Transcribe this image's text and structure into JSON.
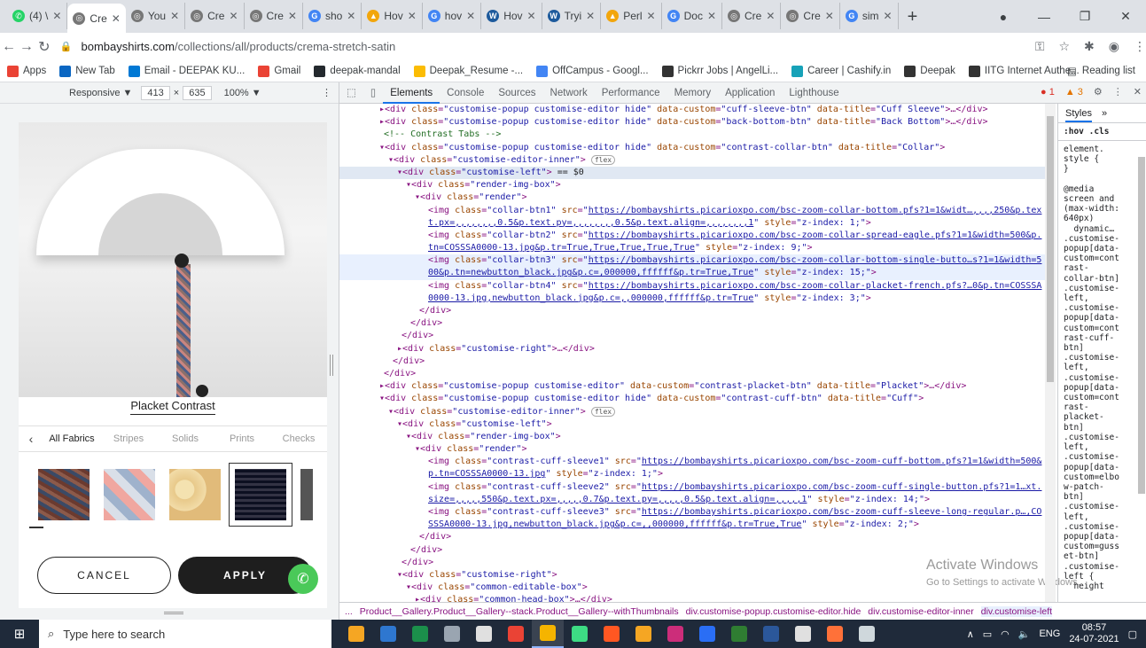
{
  "browser": {
    "tabs": [
      {
        "label": "(4) \\",
        "color": "#25d366",
        "glyph": "✆"
      },
      {
        "label": "Cre",
        "color": "#777777",
        "glyph": "◎",
        "active": true
      },
      {
        "label": "You",
        "color": "#777777",
        "glyph": "◎"
      },
      {
        "label": "Cre",
        "color": "#777777",
        "glyph": "◎"
      },
      {
        "label": "Cre",
        "color": "#777777",
        "glyph": "◎"
      },
      {
        "label": "sho",
        "color": "#4285f4",
        "glyph": "G"
      },
      {
        "label": "Hov",
        "color": "#f2a60c",
        "glyph": "▲"
      },
      {
        "label": "hov",
        "color": "#4285f4",
        "glyph": "G"
      },
      {
        "label": "Hov",
        "color": "#1d5a9c",
        "glyph": "W"
      },
      {
        "label": "Tryi",
        "color": "#1d5a9c",
        "glyph": "W"
      },
      {
        "label": "Perl",
        "color": "#f2a60c",
        "glyph": "▲"
      },
      {
        "label": "Doc",
        "color": "#4285f4",
        "glyph": "G"
      },
      {
        "label": "Cre",
        "color": "#777777",
        "glyph": "◎"
      },
      {
        "label": "Cre",
        "color": "#777777",
        "glyph": "◎"
      },
      {
        "label": "sim",
        "color": "#4285f4",
        "glyph": "G"
      }
    ],
    "url_host": "bombayshirts.com",
    "url_path": "/collections/all/products/crema-stretch-satin",
    "bookmarks": [
      {
        "label": "Apps",
        "color": "#ea4335"
      },
      {
        "label": "New Tab",
        "color": "#0a66c2"
      },
      {
        "label": "Email - DEEPAK KU...",
        "color": "#0078d4"
      },
      {
        "label": "Gmail",
        "color": "#ea4335"
      },
      {
        "label": "deepak-mandal",
        "color": "#24292e"
      },
      {
        "label": "Deepak_Resume -...",
        "color": "#fbbc04"
      },
      {
        "label": "OffCampus - Googl...",
        "color": "#4285f4"
      },
      {
        "label": "Pickrr Jobs | AngelLi...",
        "color": "#333333"
      },
      {
        "label": "Career | Cashify.in",
        "color": "#17a2b8"
      },
      {
        "label": "Deepak",
        "color": "#333333"
      },
      {
        "label": "IITG Internet Authe...",
        "color": "#333333"
      }
    ],
    "reading_list": "Reading list"
  },
  "device_toolbar": {
    "mode": "Responsive ▼",
    "width": "413",
    "times": "×",
    "height": "635",
    "zoom": "100% ▼"
  },
  "mobile": {
    "placket_title": "Placket Contrast",
    "filters": [
      "All Fabrics",
      "Stripes",
      "Solids",
      "Prints",
      "Checks"
    ],
    "cancel": "CANCEL",
    "apply": "APPLY"
  },
  "devtools": {
    "tabs": [
      "Elements",
      "Console",
      "Sources",
      "Network",
      "Performance",
      "Memory",
      "Application",
      "Lighthouse"
    ],
    "errors": "1",
    "warnings": "3",
    "styles_tab": "Styles",
    "styles_more": "»",
    "styles_filter": ":hov .cls",
    "styles_text": "element.\nstyle {\n}\n\n@media\nscreen and\n(max-width:\n640px)\n  dynamic…\n.customise-\npopup[data-\ncustom=cont\nrast-\ncollar-btn]\n.customise-\nleft,\n.customise-\npopup[data-\ncustom=cont\nrast-cuff-\nbtn]\n.customise-\nleft,\n.customise-\npopup[data-\ncustom=cont\nrast-\nplacket-\nbtn]\n.customise-\nleft,\n.customise-\npopup[data-\ncustom=elbo\nw-patch-\nbtn]\n.customise-\nleft,\n.customise-\npopup[data-\ncustom=guss\net-btn]\n.customise-\nleft {\n  height",
    "activate_title": "Activate Windows",
    "activate_sub": "Go to Settings to activate Windows.",
    "breadcrumbs": [
      "...",
      "Product__Gallery.Product__Gallery--stack.Product__Gallery--withThumbnails",
      "div.customise-popup.customise-editor.hide",
      "div.customise-editor-inner",
      "div.customise-left"
    ],
    "code_lines": [
      {
        "indent": 9,
        "html": "▸<span class='tag'>&lt;div</span> <span class='attr'>class</span>=<span class='val'>\"customise-popup customise-editor hide\"</span> <span class='attr'>data-custom</span>=<span class='val'>\"cuff-sleeve-btn\"</span> <span class='attr'>data-title</span>=<span class='val'>\"Cuff Sleeve\"</span><span class='tag'>&gt;</span>…<span class='tag'>&lt;/div&gt;</span>"
      },
      {
        "indent": 9,
        "html": "▸<span class='tag'>&lt;div</span> <span class='attr'>class</span>=<span class='val'>\"customise-popup customise-editor hide\"</span> <span class='attr'>data-custom</span>=<span class='val'>\"back-bottom-btn\"</span> <span class='attr'>data-title</span>=<span class='val'>\"Back Bottom\"</span><span class='tag'>&gt;</span>…<span class='tag'>&lt;/div&gt;</span>"
      },
      {
        "indent": 10,
        "html": "<span class='cmt'>&lt;!-- Contrast Tabs --&gt;</span>"
      },
      {
        "indent": 9,
        "html": "▾<span class='tag'>&lt;div</span> <span class='attr'>class</span>=<span class='val'>\"customise-popup customise-editor hide\"</span> <span class='attr'>data-custom</span>=<span class='val'>\"contrast-collar-btn\"</span> <span class='attr'>data-title</span>=<span class='val'>\"Collar\"</span><span class='tag'>&gt;</span>"
      },
      {
        "indent": 11,
        "html": "▾<span class='tag'>&lt;div</span> <span class='attr'>class</span>=<span class='val'>\"customise-editor-inner\"</span><span class='tag'>&gt;</span> <span class='badge'>flex</span>"
      },
      {
        "indent": 13,
        "hl": true,
        "html": "▾<span class='tag'>&lt;div</span> <span class='attr'>class</span>=<span class='val'>\"customise-left\"</span><span class='tag'>&gt;</span> <span class='txt'>== $0</span>"
      },
      {
        "indent": 15,
        "html": "▾<span class='tag'>&lt;div</span> <span class='attr'>class</span>=<span class='val'>\"render-img-box\"</span><span class='tag'>&gt;</span>"
      },
      {
        "indent": 17,
        "html": "▾<span class='tag'>&lt;div</span> <span class='attr'>class</span>=<span class='val'>\"render\"</span><span class='tag'>&gt;</span>"
      },
      {
        "indent": 20,
        "html": "<span class='tag'>&lt;img</span> <span class='attr'>class</span>=<span class='val'>\"collar-btn1\"</span> <span class='attr'>src</span>=<span class='val'>\"</span><span class='link'>https://bombayshirts.picarioxpo.com/bsc-zoom-collar-bottom.pfs?1=1&amp;widt…,,,,250&amp;p.tex</span>"
      },
      {
        "indent": 20,
        "html": "<span class='link'>t.px=,,,,,,,,0.5&amp;p.text.py=,,,,,,,,0.5&amp;p.text.align=,,,,,,,,1</span><span class='val'>\"</span> <span class='attr'>style</span>=<span class='val'>\"z-index: 1;\"</span><span class='tag'>&gt;</span>"
      },
      {
        "indent": 20,
        "html": "<span class='tag'>&lt;img</span> <span class='attr'>class</span>=<span class='val'>\"collar-btn2\"</span> <span class='attr'>src</span>=<span class='val'>\"</span><span class='link'>https://bombayshirts.picarioxpo.com/bsc-zoom-collar-spread-eagle.pfs?1=1&amp;width=500&amp;p.</span>"
      },
      {
        "indent": 20,
        "html": "<span class='link'>tn=COSSSA0000-13.jpg&amp;p.tr=True,True,True,True,True</span><span class='val'>\"</span> <span class='attr'>style</span>=<span class='val'>\"z-index: 9;\"</span><span class='tag'>&gt;</span>"
      },
      {
        "indent": 20,
        "hl2": true,
        "html": "<span class='tag'>&lt;img</span> <span class='attr'>class</span>=<span class='val'>\"collar-btn3\"</span> <span class='attr'>src</span>=<span class='val'>\"</span><span class='link'>https://bombayshirts.picarioxpo.com/bsc-zoom-collar-bottom-single-butto…s?1=1&amp;width=5</span>"
      },
      {
        "indent": 20,
        "hl2": true,
        "html": "<span class='link'>00&amp;p.tn=newbutton_black.jpg&amp;p.c=,000000,ffffff&amp;p.tr=True,True</span><span class='val'>\"</span> <span class='attr'>style</span>=<span class='val'>\"z-index: 15;\"</span><span class='tag'>&gt;</span>"
      },
      {
        "indent": 20,
        "html": "<span class='tag'>&lt;img</span> <span class='attr'>class</span>=<span class='val'>\"collar-btn4\"</span> <span class='attr'>src</span>=<span class='val'>\"</span><span class='link'>https://bombayshirts.picarioxpo.com/bsc-zoom-collar-placket-french.pfs?…0&amp;p.tn=COSSSA</span>"
      },
      {
        "indent": 20,
        "html": "<span class='link'>0000-13.jpg,newbutton_black.jpg&amp;p.c=,,000000,ffffff&amp;p.tr=True</span><span class='val'>\"</span> <span class='attr'>style</span>=<span class='val'>\"z-index: 3;\"</span><span class='tag'>&gt;</span>"
      },
      {
        "indent": 18,
        "html": "<span class='tag'>&lt;/div&gt;</span>"
      },
      {
        "indent": 16,
        "html": "<span class='tag'>&lt;/div&gt;</span>"
      },
      {
        "indent": 14,
        "html": "<span class='tag'>&lt;/div&gt;</span>"
      },
      {
        "indent": 13,
        "html": "▸<span class='tag'>&lt;div</span> <span class='attr'>class</span>=<span class='val'>\"customise-right\"</span><span class='tag'>&gt;</span>…<span class='tag'>&lt;/div&gt;</span>"
      },
      {
        "indent": 12,
        "html": "<span class='tag'>&lt;/div&gt;</span>"
      },
      {
        "indent": 10,
        "html": "<span class='tag'>&lt;/div&gt;</span>"
      },
      {
        "indent": 9,
        "html": "▸<span class='tag'>&lt;div</span> <span class='attr'>class</span>=<span class='val'>\"customise-popup customise-editor\"</span> <span class='attr'>data-custom</span>=<span class='val'>\"contrast-placket-btn\"</span> <span class='attr'>data-title</span>=<span class='val'>\"Placket\"</span><span class='tag'>&gt;</span>…<span class='tag'>&lt;/div&gt;</span>"
      },
      {
        "indent": 9,
        "html": "▾<span class='tag'>&lt;div</span> <span class='attr'>class</span>=<span class='val'>\"customise-popup customise-editor hide\"</span> <span class='attr'>data-custom</span>=<span class='val'>\"contrast-cuff-btn\"</span> <span class='attr'>data-title</span>=<span class='val'>\"Cuff\"</span><span class='tag'>&gt;</span>"
      },
      {
        "indent": 11,
        "html": "▾<span class='tag'>&lt;div</span> <span class='attr'>class</span>=<span class='val'>\"customise-editor-inner\"</span><span class='tag'>&gt;</span> <span class='badge'>flex</span>"
      },
      {
        "indent": 13,
        "html": "▾<span class='tag'>&lt;div</span> <span class='attr'>class</span>=<span class='val'>\"customise-left\"</span><span class='tag'>&gt;</span>"
      },
      {
        "indent": 15,
        "html": "▾<span class='tag'>&lt;div</span> <span class='attr'>class</span>=<span class='val'>\"render-img-box\"</span><span class='tag'>&gt;</span>"
      },
      {
        "indent": 17,
        "html": "▾<span class='tag'>&lt;div</span> <span class='attr'>class</span>=<span class='val'>\"render\"</span><span class='tag'>&gt;</span>"
      },
      {
        "indent": 20,
        "html": "<span class='tag'>&lt;img</span> <span class='attr'>class</span>=<span class='val'>\"contrast-cuff-sleeve1\"</span> <span class='attr'>src</span>=<span class='val'>\"</span><span class='link'>https://bombayshirts.picarioxpo.com/bsc-zoom-cuff-bottom.pfs?1=1&amp;width=500&amp;</span>"
      },
      {
        "indent": 20,
        "html": "<span class='link'>p.tn=COSSSA0000-13.jpg</span><span class='val'>\"</span> <span class='attr'>style</span>=<span class='val'>\"z-index: 1;\"</span><span class='tag'>&gt;</span>"
      },
      {
        "indent": 20,
        "html": "<span class='tag'>&lt;img</span> <span class='attr'>class</span>=<span class='val'>\"contrast-cuff-sleeve2\"</span> <span class='attr'>src</span>=<span class='val'>\"</span><span class='link'>https://bombayshirts.picarioxpo.com/bsc-zoom-cuff-single-button.pfs?1=1…xt.</span>"
      },
      {
        "indent": 20,
        "html": "<span class='link'>size=,,,,,550&amp;p.text.px=,,,,,0.7&amp;p.text.py=,,,,,0.5&amp;p.text.align=,,,,,1</span><span class='val'>\"</span> <span class='attr'>style</span>=<span class='val'>\"z-index: 14;\"</span><span class='tag'>&gt;</span>"
      },
      {
        "indent": 20,
        "html": "<span class='tag'>&lt;img</span> <span class='attr'>class</span>=<span class='val'>\"contrast-cuff-sleeve3\"</span> <span class='attr'>src</span>=<span class='val'>\"</span><span class='link'>https://bombayshirts.picarioxpo.com/bsc-zoom-cuff-sleeve-long-regular.p…,CO</span>"
      },
      {
        "indent": 20,
        "html": "<span class='link'>SSSA0000-13.jpg,newbutton_black.jpg&amp;p.c=,,000000,ffffff&amp;p.tr=True,True</span><span class='val'>\"</span> <span class='attr'>style</span>=<span class='val'>\"z-index: 2;\"</span><span class='tag'>&gt;</span>"
      },
      {
        "indent": 18,
        "html": "<span class='tag'>&lt;/div&gt;</span>"
      },
      {
        "indent": 16,
        "html": "<span class='tag'>&lt;/div&gt;</span>"
      },
      {
        "indent": 14,
        "html": "<span class='tag'>&lt;/div&gt;</span>"
      },
      {
        "indent": 13,
        "html": "▾<span class='tag'>&lt;div</span> <span class='attr'>class</span>=<span class='val'>\"customise-right\"</span><span class='tag'>&gt;</span>"
      },
      {
        "indent": 15,
        "html": "▾<span class='tag'>&lt;div</span> <span class='attr'>class</span>=<span class='val'>\"common-editable-box\"</span><span class='tag'>&gt;</span>"
      },
      {
        "indent": 17,
        "html": "▸<span class='tag'>&lt;div</span> <span class='attr'>class</span>=<span class='val'>\"common-head-box\"</span><span class='tag'>&gt;</span>…<span class='tag'>&lt;/div&gt;</span>"
      }
    ]
  },
  "taskbar": {
    "search_placeholder": "Type here to search",
    "apps": [
      "#f5a623",
      "#2e77d0",
      "#1b8f4b",
      "#9aa5b1",
      "#e0e0e0",
      "#ea4335",
      "#f5b400",
      "#3ddc84",
      "#ff5722",
      "#f5a623",
      "#cc2d7a",
      "#2a6ef5",
      "#2f7d32",
      "#2b579a",
      "#e0e0e0",
      "#ff7139",
      "#cfd8dc"
    ],
    "lang": "ENG",
    "time": "08:57",
    "date": "24-07-2021"
  }
}
